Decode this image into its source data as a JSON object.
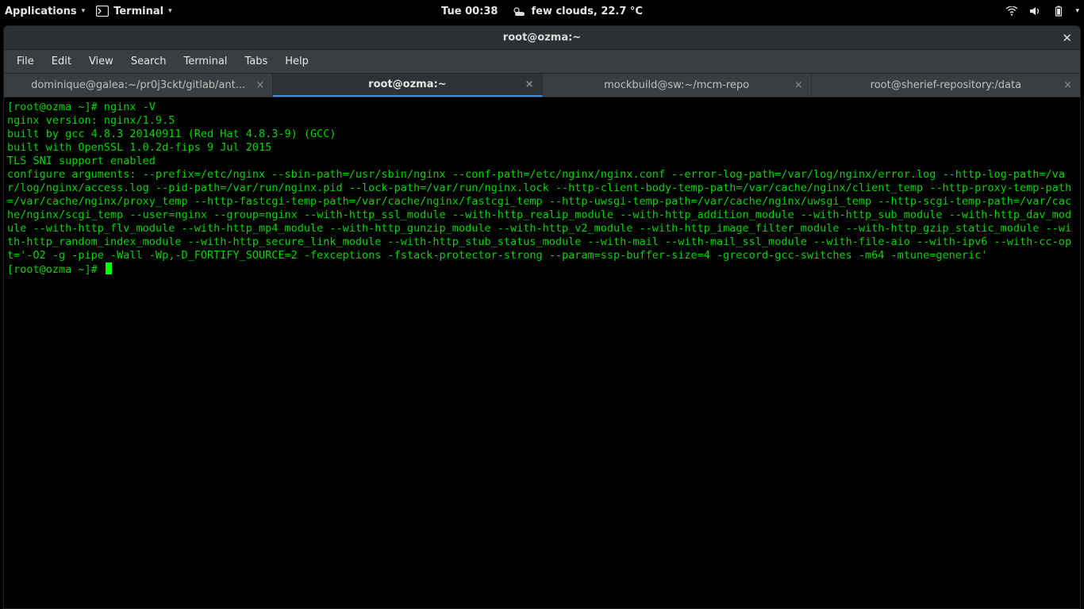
{
  "topbar": {
    "applications": "Applications",
    "terminal": "Terminal",
    "clock": "Tue 00:38",
    "weather": "few clouds, 22.7 °C"
  },
  "window": {
    "title": "root@ozma:~"
  },
  "menubar": {
    "items": [
      "File",
      "Edit",
      "View",
      "Search",
      "Terminal",
      "Tabs",
      "Help"
    ]
  },
  "tabs": [
    {
      "label": "dominique@galea:~/pr0j3ckt/gitlab/ant...",
      "active": false
    },
    {
      "label": "root@ozma:~",
      "active": true
    },
    {
      "label": "mockbuild@sw:~/mcm-repo",
      "active": false
    },
    {
      "label": "root@sherief-repository:/data",
      "active": false
    }
  ],
  "terminal": {
    "prompt1": "[root@ozma ~]# ",
    "cmd1": "nginx -V",
    "output": "nginx version: nginx/1.9.5\nbuilt by gcc 4.8.3 20140911 (Red Hat 4.8.3-9) (GCC)\nbuilt with OpenSSL 1.0.2d-fips 9 Jul 2015\nTLS SNI support enabled\nconfigure arguments: --prefix=/etc/nginx --sbin-path=/usr/sbin/nginx --conf-path=/etc/nginx/nginx.conf --error-log-path=/var/log/nginx/error.log --http-log-path=/var/log/nginx/access.log --pid-path=/var/run/nginx.pid --lock-path=/var/run/nginx.lock --http-client-body-temp-path=/var/cache/nginx/client_temp --http-proxy-temp-path=/var/cache/nginx/proxy_temp --http-fastcgi-temp-path=/var/cache/nginx/fastcgi_temp --http-uwsgi-temp-path=/var/cache/nginx/uwsgi_temp --http-scgi-temp-path=/var/cache/nginx/scgi_temp --user=nginx --group=nginx --with-http_ssl_module --with-http_realip_module --with-http_addition_module --with-http_sub_module --with-http_dav_module --with-http_flv_module --with-http_mp4_module --with-http_gunzip_module --with-http_v2_module --with-http_image_filter_module --with-http_gzip_static_module --with-http_random_index_module --with-http_secure_link_module --with-http_stub_status_module --with-mail --with-mail_ssl_module --with-file-aio --with-ipv6 --with-cc-opt='-O2 -g -pipe -Wall -Wp,-D_FORTIFY_SOURCE=2 -fexceptions -fstack-protector-strong --param=ssp-buffer-size=4 -grecord-gcc-switches -m64 -mtune=generic'",
    "prompt2": "[root@ozma ~]# "
  }
}
